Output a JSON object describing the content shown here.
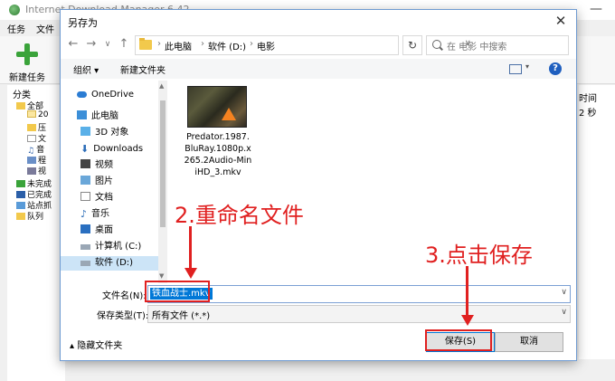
{
  "background_window": {
    "title": "Internet Download Manager 6.42",
    "menu": [
      "任务",
      "文件"
    ],
    "toolbar_new_task": "新建任务",
    "sidebar_title": "分类",
    "tree": [
      "全部",
      "20",
      "压",
      "文",
      "音",
      "程",
      "视",
      "未完成",
      "已完成",
      "站点抓",
      "队列"
    ],
    "right_col_header": "时间",
    "right_col_value": "2 秒",
    "minimize": "—"
  },
  "dialog": {
    "title": "另存为",
    "close": "✕",
    "breadcrumb": [
      "此电脑",
      "软件 (D:)",
      "电影"
    ],
    "search_placeholder": "在 电影 中搜索",
    "organize": "组织 ▾",
    "new_folder": "新建文件夹",
    "help": "?",
    "nav_items": [
      {
        "label": "OneDrive",
        "icon": "cloud"
      },
      {
        "label": "此电脑",
        "icon": "pc"
      },
      {
        "label": "3D 对象",
        "icon": "cube"
      },
      {
        "label": "Downloads",
        "icon": "download"
      },
      {
        "label": "视频",
        "icon": "video"
      },
      {
        "label": "图片",
        "icon": "picture"
      },
      {
        "label": "文档",
        "icon": "document"
      },
      {
        "label": "音乐",
        "icon": "music"
      },
      {
        "label": "桌面",
        "icon": "desktop"
      },
      {
        "label": "计算机 (C:)",
        "icon": "drive"
      },
      {
        "label": "软件 (D:)",
        "icon": "drive"
      }
    ],
    "file": {
      "name_lines": [
        "Predator.1987.",
        "BluRay.1080p.x",
        "265.2Audio-Min",
        "iHD_3.mkv"
      ]
    },
    "filename_label": "文件名(N):",
    "filename_value": "铁血战士.mkv",
    "filetype_label": "保存类型(T):",
    "filetype_value": "所有文件 (*.*)",
    "hide_folders": "隐藏文件夹",
    "save_button": "保存(S)",
    "cancel_button": "取消"
  },
  "annotations": {
    "step2": "2.重命名文件",
    "step3": "3.点击保存"
  },
  "colors": {
    "annotation_red": "#e02020",
    "selection_blue": "#0078d7",
    "nav_selected": "#cce4f7"
  }
}
